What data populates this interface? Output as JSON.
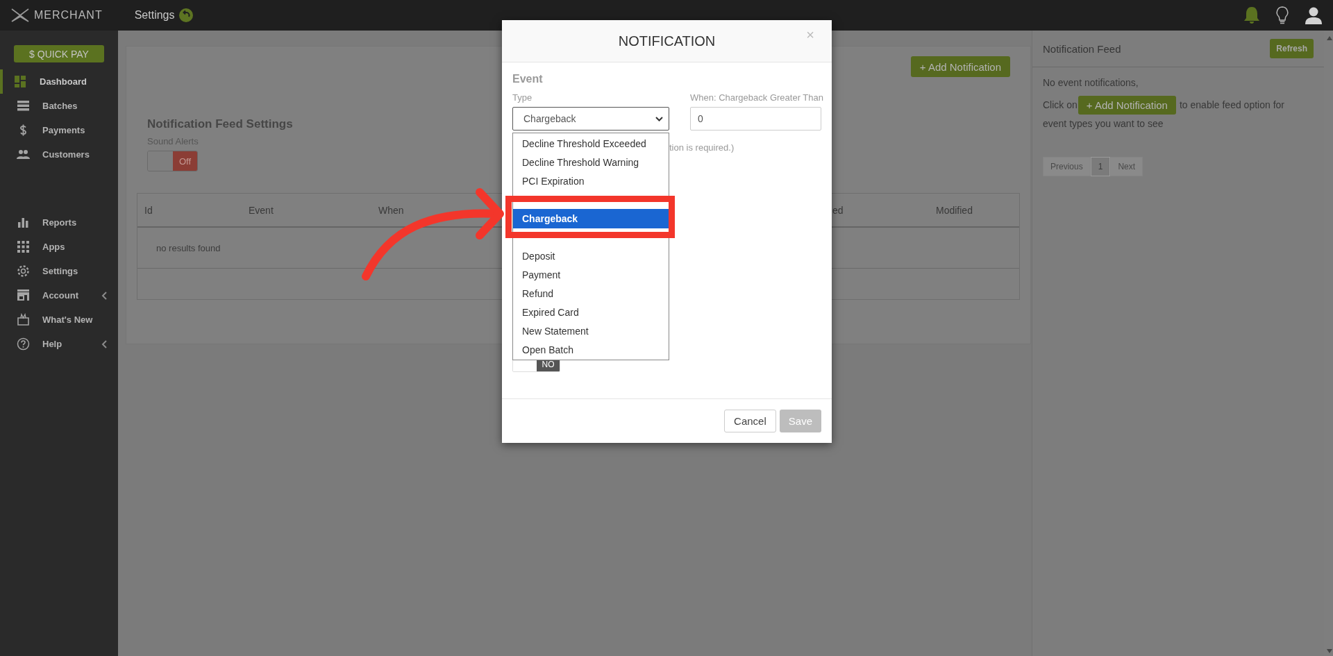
{
  "topbar": {
    "logo": "MERCHANT",
    "page_title": "Settings"
  },
  "sidebar": {
    "quick_pay": "$ QUICK PAY",
    "groups": [
      [
        {
          "label": "Dashboard",
          "selected": true,
          "expandable": false
        },
        {
          "label": "Batches",
          "selected": false,
          "expandable": false
        },
        {
          "label": "Payments",
          "selected": false,
          "expandable": false
        },
        {
          "label": "Customers",
          "selected": false,
          "expandable": false
        }
      ],
      [
        {
          "label": "Reports",
          "selected": false,
          "expandable": false
        },
        {
          "label": "Apps",
          "selected": false,
          "expandable": false
        },
        {
          "label": "Settings",
          "selected": false,
          "expandable": false
        },
        {
          "label": "Account",
          "selected": false,
          "expandable": true
        },
        {
          "label": "What's New",
          "selected": false,
          "expandable": false
        },
        {
          "label": "Help",
          "selected": false,
          "expandable": true
        }
      ]
    ]
  },
  "settings_card": {
    "add_button": "+ Add Notification",
    "section_title": "Notification Feed Settings",
    "sound_alerts": {
      "label": "Sound Alerts",
      "on": false,
      "text": "Off"
    },
    "table": {
      "columns": [
        "Id",
        "Event",
        "When",
        "ed",
        "Modified"
      ],
      "empty_message": "no results found"
    }
  },
  "notification_feed": {
    "title": "Notification Feed",
    "refresh": "Refresh",
    "empty": "No event notifications,",
    "hint_before": "Click on",
    "hint_button": "+ Add Notification",
    "hint_after": "to enable feed option for",
    "hint_line_2": "event types you want to see",
    "pagination": {
      "previous": "Previous",
      "pages": [
        {
          "label": "1",
          "selected": true
        }
      ],
      "next": "Next"
    }
  },
  "modal": {
    "title": "NOTIFICATION",
    "close": "×",
    "section": "Event",
    "type_label": "Type",
    "type_value": "Chargeback",
    "when_label": "When: Chargeback Greater Than",
    "when_value": "0",
    "note": "tion is required.)",
    "toggle": {
      "on": false,
      "text": "NO"
    },
    "options": [
      {
        "label": "Decline Threshold Exceeded",
        "selected": false
      },
      {
        "label": "Decline Threshold Warning",
        "selected": false
      },
      {
        "label": "PCI Expiration",
        "selected": false
      },
      {
        "label": "Chargeback",
        "selected": true
      },
      {
        "label": "Deposit",
        "selected": false
      },
      {
        "label": "Payment",
        "selected": false
      },
      {
        "label": "Refund",
        "selected": false
      },
      {
        "label": "Expired Card",
        "selected": false
      },
      {
        "label": "New Statement",
        "selected": false
      },
      {
        "label": "Open Batch",
        "selected": false
      }
    ],
    "cancel": "Cancel",
    "save": {
      "label": "Save",
      "disabled": true
    }
  }
}
